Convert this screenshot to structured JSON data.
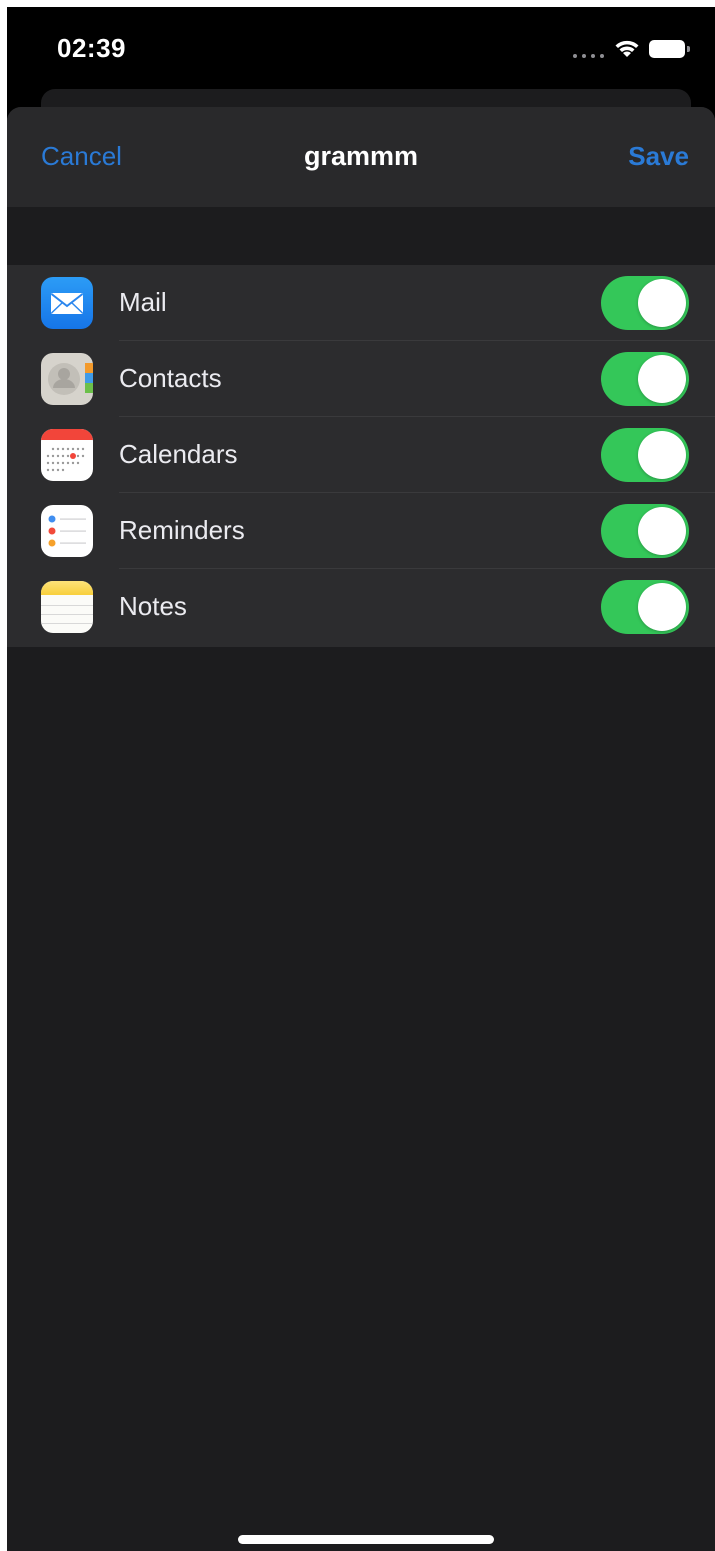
{
  "status_bar": {
    "time": "02:39",
    "icons": [
      "signal-dots-icon",
      "wifi-icon",
      "battery-icon"
    ]
  },
  "nav": {
    "cancel_label": "Cancel",
    "title": "grammm",
    "save_label": "Save"
  },
  "colors": {
    "accent": "#2a7ad6",
    "toggle_on": "#34c759",
    "sheet_bg": "#1c1c1e",
    "row_bg": "#2c2c2e"
  },
  "services": [
    {
      "label": "Mail",
      "icon": "mail-icon",
      "enabled": true
    },
    {
      "label": "Contacts",
      "icon": "contacts-icon",
      "enabled": true
    },
    {
      "label": "Calendars",
      "icon": "calendar-icon",
      "enabled": true
    },
    {
      "label": "Reminders",
      "icon": "reminders-icon",
      "enabled": true
    },
    {
      "label": "Notes",
      "icon": "notes-icon",
      "enabled": true
    }
  ]
}
